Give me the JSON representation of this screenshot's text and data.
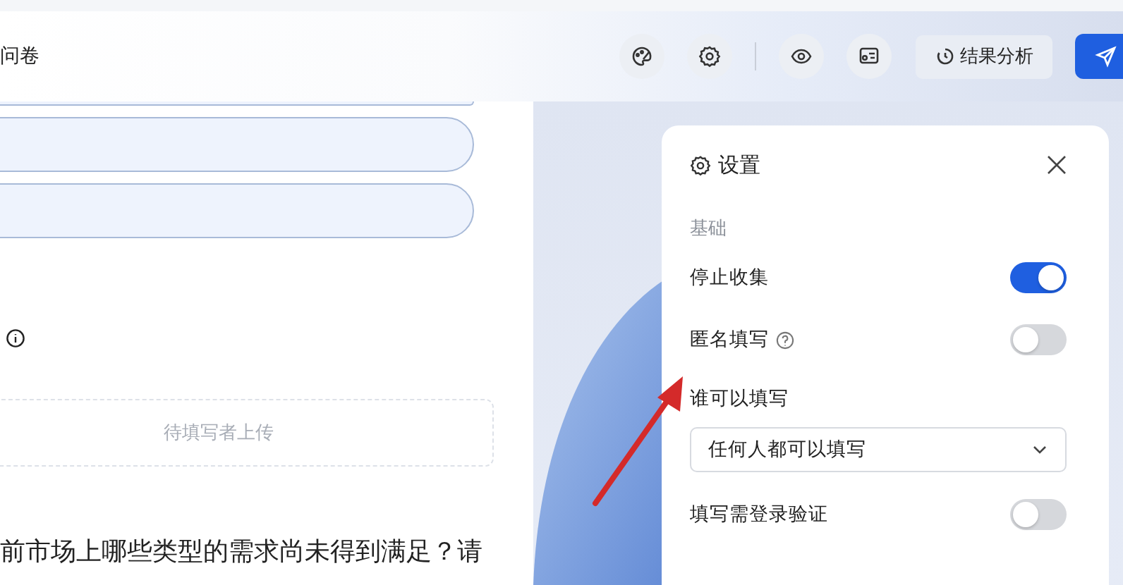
{
  "header": {
    "title": "问卷",
    "analysis_button": "结果分析"
  },
  "form": {
    "upload_hint": "待填写者上传",
    "question": "前市场上哪些类型的需求尚未得到满足？请"
  },
  "settings": {
    "title": "设置",
    "section": "基础",
    "rows": [
      {
        "kind": "toggle",
        "label": "停止收集",
        "on": true
      },
      {
        "kind": "toggle",
        "label": "匿名填写",
        "help": true,
        "on": false
      },
      {
        "kind": "select",
        "label": "谁可以填写",
        "value": "任何人都可以填写"
      },
      {
        "kind": "toggle",
        "label": "填写需登录验证",
        "on": false
      }
    ]
  }
}
